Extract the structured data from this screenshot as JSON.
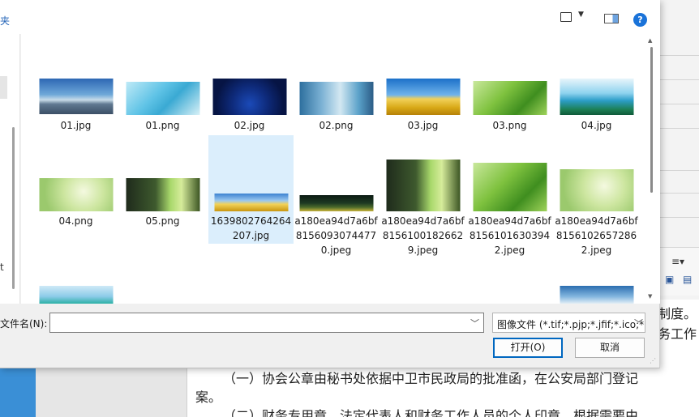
{
  "dialog": {
    "toolbar_label": "夹",
    "view_menu_icon": "view-list-icon",
    "preview_icon": "preview-pane-icon",
    "help_label": "?",
    "nav_fragment": "t"
  },
  "files": [
    {
      "name": "01.jpg",
      "thumb": "city"
    },
    {
      "name": "01.png",
      "thumb": "lab"
    },
    {
      "name": "02.jpg",
      "thumb": "space"
    },
    {
      "name": "02.png",
      "thumb": "flask"
    },
    {
      "name": "03.jpg",
      "thumb": "field"
    },
    {
      "name": "03.png",
      "thumb": "leaf"
    },
    {
      "name": "04.jpg",
      "thumb": "island"
    },
    {
      "name": "04.png",
      "thumb": "sprout"
    },
    {
      "name": "05.png",
      "thumb": "drop"
    },
    {
      "name": "1639802764264207.jpg",
      "thumb": "wide",
      "selected": true
    },
    {
      "name": "a180ea94d7a6bf81560930744770.jpeg",
      "thumb": "dark"
    },
    {
      "name": "a180ea94d7a6bf81561001826629.jpeg",
      "thumb": "drop"
    },
    {
      "name": "a180ea94d7a6bf81561016303942.jpeg",
      "thumb": "leaf"
    },
    {
      "name": "a180ea94d7a6bf81561026572862.jpeg",
      "thumb": "sprout"
    }
  ],
  "filename": {
    "label": "文件名(N):",
    "value": "",
    "placeholder": ""
  },
  "filetype": {
    "selected": "图像文件 (*.tif;*.pjp;*.jfif;*.ico;*"
  },
  "buttons": {
    "open": "打开(O)",
    "cancel": "取消"
  },
  "document": {
    "line1": "制度。",
    "line2": "务工作",
    "line3": "（一）协会公章由秘书处依据中卫市民政局的批准函，在公安局部门登记",
    "line4": "案。",
    "line5": "（二）财务专用章、法定代表人和财务工作人员的个人印章，根据需要由"
  }
}
